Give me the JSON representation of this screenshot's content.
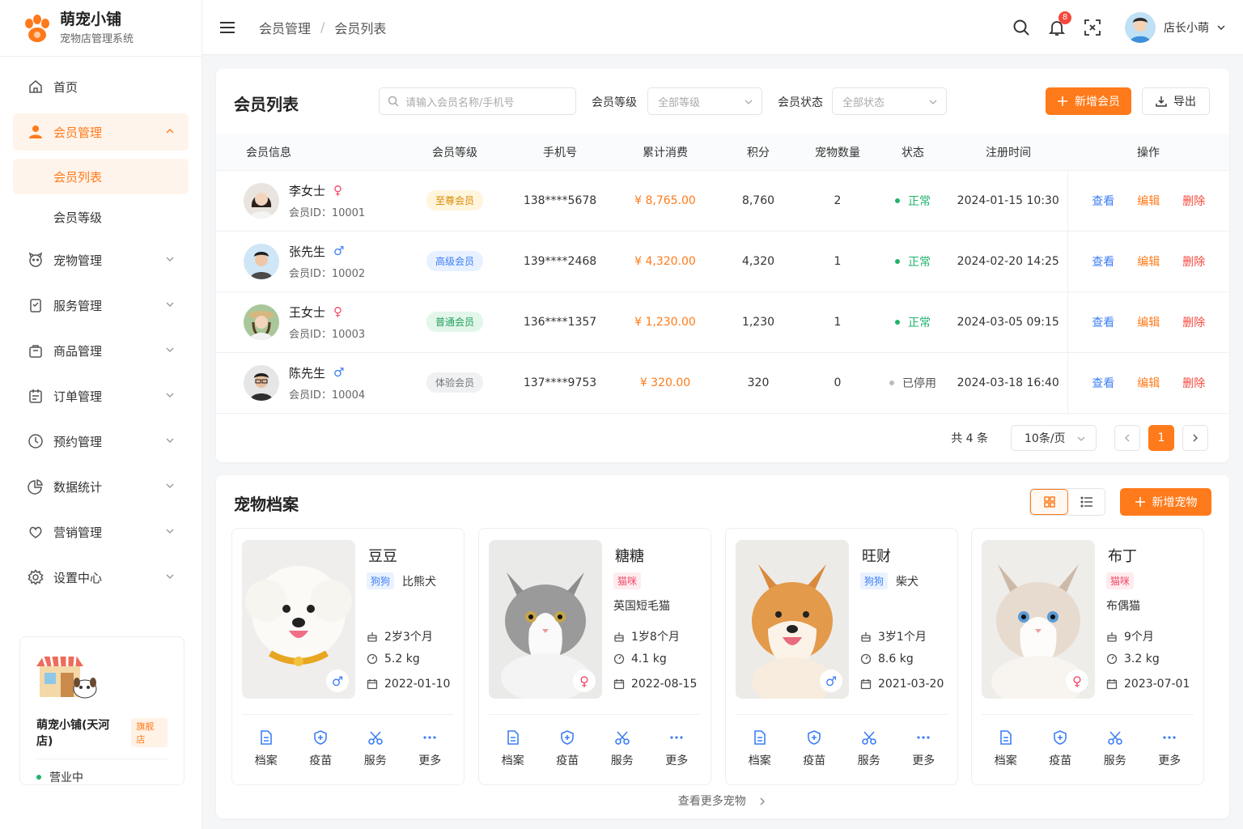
{
  "brand": {
    "title": "萌宠小铺",
    "subtitle": "宠物店管理系统"
  },
  "nav": {
    "home": "首页",
    "member": "会员管理",
    "member_list": "会员列表",
    "member_level": "会员等级",
    "pet": "宠物管理",
    "service": "服务管理",
    "goods": "商品管理",
    "order": "订单管理",
    "booking": "预约管理",
    "stats": "数据统计",
    "marketing": "营销管理",
    "settings": "设置中心"
  },
  "store": {
    "name": "萌宠小铺(天河店)",
    "badge": "旗舰店",
    "status": "营业中"
  },
  "breadcrumb": {
    "parent": "会员管理",
    "current": "会员列表"
  },
  "header": {
    "notif_count": "8",
    "user_name": "店长小萌"
  },
  "members": {
    "title": "会员列表",
    "search_placeholder": "请输入会员名称/手机号",
    "level_label": "会员等级",
    "level_value": "全部等级",
    "status_label": "会员状态",
    "status_value": "全部状态",
    "add_button": "新增会员",
    "export_button": "导出",
    "columns": [
      "会员信息",
      "会员等级",
      "手机号",
      "累计消费",
      "积分",
      "宠物数量",
      "状态",
      "注册时间",
      "操作"
    ],
    "rows": [
      {
        "name": "李女士",
        "gender": "♀",
        "id": "会员ID：10001",
        "level": "至尊会员",
        "phone": "138****5678",
        "spend": "¥ 8,765.00",
        "points": "8,760",
        "pets": "2",
        "status": "正常",
        "date": "2024-01-15 10:30"
      },
      {
        "name": "张先生",
        "gender": "♂",
        "id": "会员ID：10002",
        "level": "高级会员",
        "phone": "139****2468",
        "spend": "¥ 4,320.00",
        "points": "4,320",
        "pets": "1",
        "status": "正常",
        "date": "2024-02-20 14:25"
      },
      {
        "name": "王女士",
        "gender": "♀",
        "id": "会员ID：10003",
        "level": "普通会员",
        "phone": "136****1357",
        "spend": "¥ 1,230.00",
        "points": "1,230",
        "pets": "1",
        "status": "正常",
        "date": "2024-03-05 09:15"
      },
      {
        "name": "陈先生",
        "gender": "♂",
        "id": "会员ID：10004",
        "level": "体验会员",
        "phone": "137****9753",
        "spend": "¥ 320.00",
        "points": "320",
        "pets": "0",
        "status": "已停用",
        "date": "2024-03-18 16:40"
      }
    ],
    "ops": {
      "view": "查看",
      "edit": "编辑",
      "delete": "删除"
    },
    "pagination": {
      "total": "共 4 条",
      "page_size": "10条/页",
      "current": "1"
    }
  },
  "pets": {
    "title": "宠物档案",
    "add_button": "新增宠物",
    "more_link": "查看更多宠物",
    "actions": {
      "file": "档案",
      "vaccine": "疫苗",
      "service": "服务",
      "more": "更多"
    },
    "items": [
      {
        "name": "豆豆",
        "tag": "狗狗",
        "breed": "比熊犬",
        "age": "2岁3个月",
        "weight": "5.2 kg",
        "date": "2022-01-10",
        "gender": "♂"
      },
      {
        "name": "糖糖",
        "tag": "猫咪",
        "breed": "英国短毛猫",
        "age": "1岁8个月",
        "weight": "4.1 kg",
        "date": "2022-08-15",
        "gender": "♀"
      },
      {
        "name": "旺财",
        "tag": "狗狗",
        "breed": "柴犬",
        "age": "3岁1个月",
        "weight": "8.6 kg",
        "date": "2021-03-20",
        "gender": "♂"
      },
      {
        "name": "布丁",
        "tag": "猫咪",
        "breed": "布偶猫",
        "age": "9个月",
        "weight": "3.2 kg",
        "date": "2023-07-01",
        "gender": "♀"
      }
    ]
  },
  "colors": {
    "accent": "#ff7a1a",
    "blue": "#3d7ef5",
    "pink": "#f04a68",
    "green": "#21b36b"
  }
}
